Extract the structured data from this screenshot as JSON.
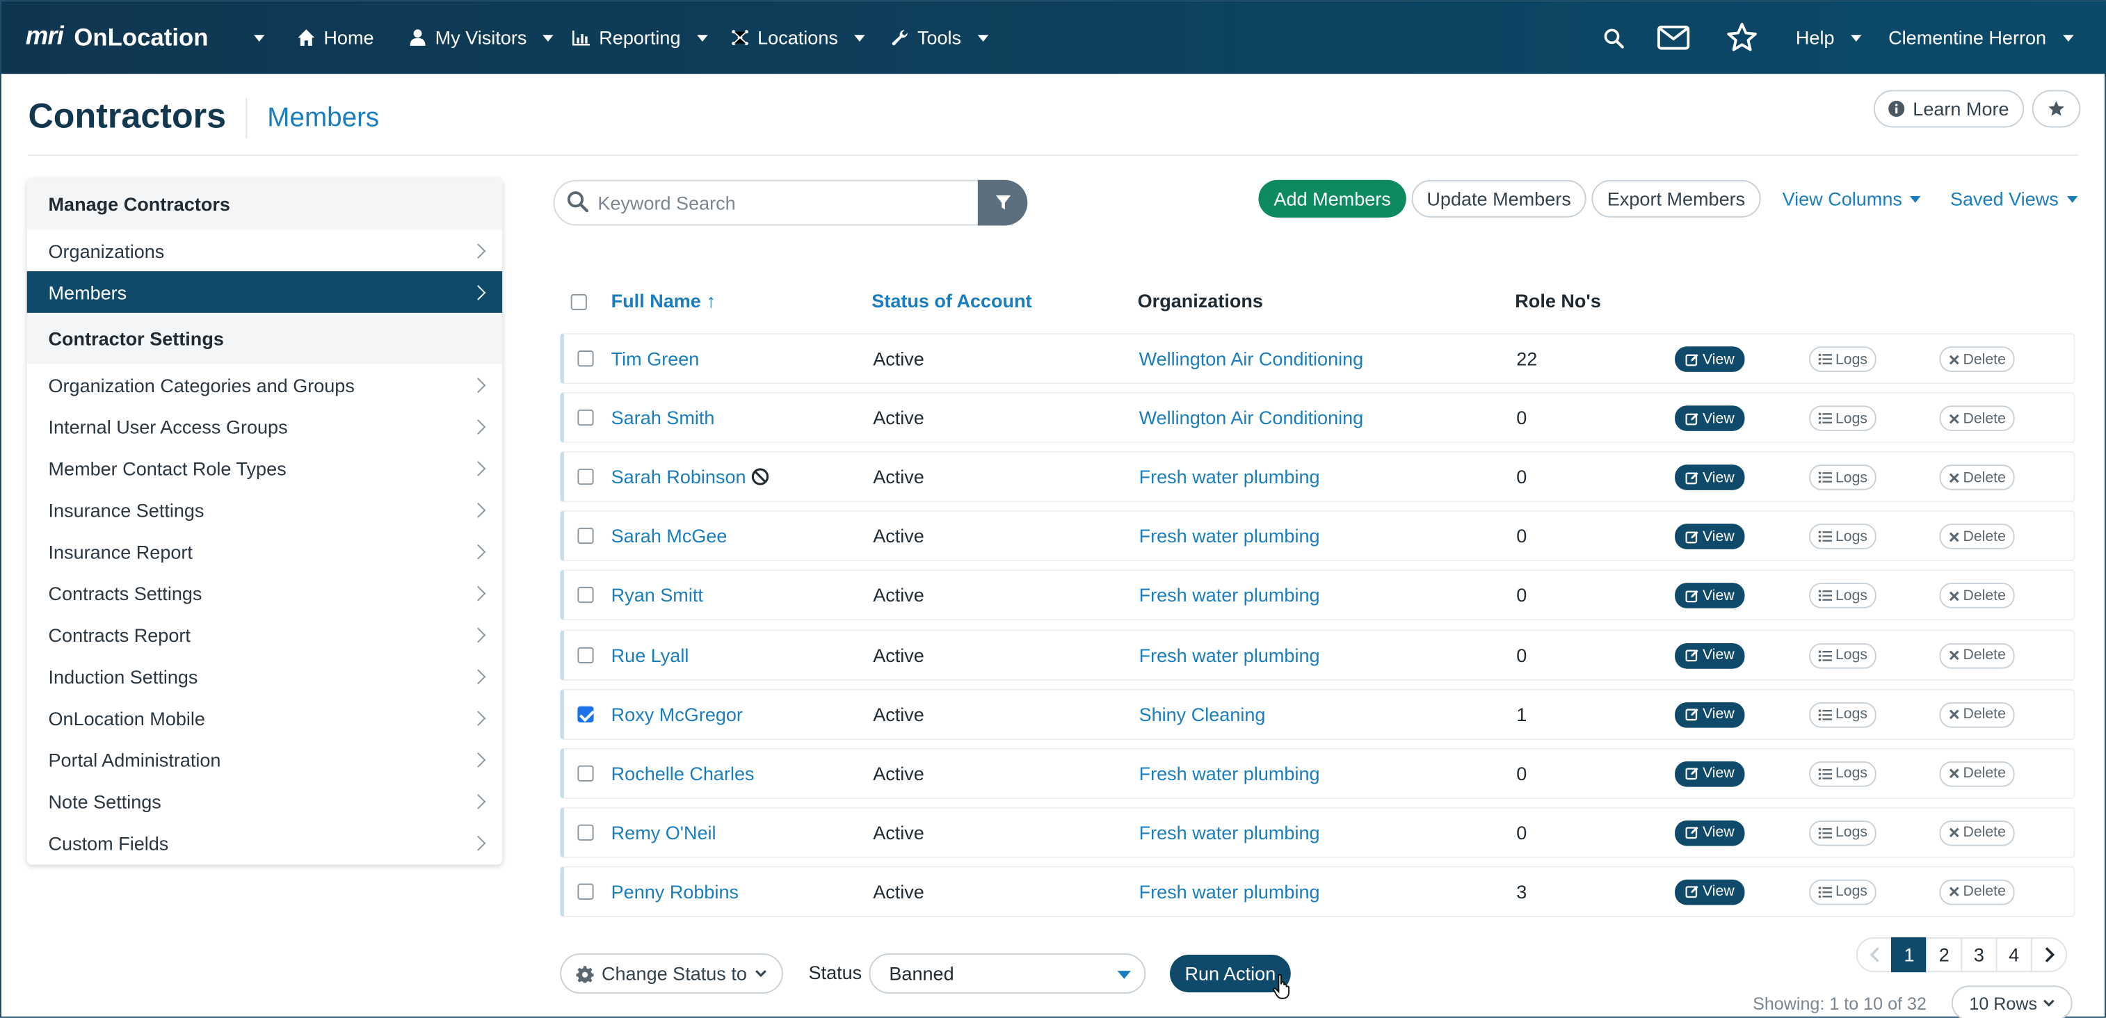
{
  "app": {
    "brand": "mri",
    "name": "OnLocation"
  },
  "topnav": {
    "items": [
      {
        "label": "Home",
        "icon": "home-icon"
      },
      {
        "label": "My Visitors",
        "icon": "user-icon"
      },
      {
        "label": "Reporting",
        "icon": "chart-icon"
      },
      {
        "label": "Locations",
        "icon": "network-icon"
      },
      {
        "label": "Tools",
        "icon": "wrench-icon"
      }
    ],
    "help": "Help",
    "user": "Clementine Herron"
  },
  "header": {
    "title": "Contractors",
    "subtitle": "Members",
    "learn_more": "Learn More"
  },
  "sidebar": {
    "section1": "Manage Contractors",
    "section1_items": [
      {
        "label": "Organizations",
        "active": false
      },
      {
        "label": "Members",
        "active": true
      }
    ],
    "section2": "Contractor Settings",
    "section2_items": [
      {
        "label": "Organization Categories and Groups"
      },
      {
        "label": "Internal User Access Groups"
      },
      {
        "label": "Member Contact Role Types"
      },
      {
        "label": "Insurance Settings"
      },
      {
        "label": "Insurance Report"
      },
      {
        "label": "Contracts Settings"
      },
      {
        "label": "Contracts Report"
      },
      {
        "label": "Induction Settings"
      },
      {
        "label": "OnLocation Mobile"
      },
      {
        "label": "Portal Administration"
      },
      {
        "label": "Note Settings"
      },
      {
        "label": "Custom Fields"
      }
    ]
  },
  "toolbar": {
    "search_placeholder": "Keyword Search",
    "add_members": "Add Members",
    "update_members": "Update Members",
    "export_members": "Export Members",
    "view_columns": "View Columns",
    "saved_views": "Saved Views"
  },
  "table": {
    "columns": {
      "full_name": "Full Name",
      "sort_arrow": "↑",
      "status": "Status of Account",
      "organizations": "Organizations",
      "role_nos": "Role No's"
    },
    "action_labels": {
      "view": "View",
      "logs": "Logs",
      "delete": "Delete"
    },
    "rows": [
      {
        "name": "Tim Green",
        "status": "Active",
        "org": "Wellington Air Conditioning",
        "role": "22",
        "checked": false,
        "banned_icon": false
      },
      {
        "name": "Sarah Smith",
        "status": "Active",
        "org": "Wellington Air Conditioning",
        "role": "0",
        "checked": false,
        "banned_icon": false
      },
      {
        "name": "Sarah Robinson",
        "status": "Active",
        "org": "Fresh water plumbing",
        "role": "0",
        "checked": false,
        "banned_icon": true
      },
      {
        "name": "Sarah McGee",
        "status": "Active",
        "org": "Fresh water plumbing",
        "role": "0",
        "checked": false,
        "banned_icon": false
      },
      {
        "name": "Ryan Smitt",
        "status": "Active",
        "org": "Fresh water plumbing",
        "role": "0",
        "checked": false,
        "banned_icon": false
      },
      {
        "name": "Rue Lyall",
        "status": "Active",
        "org": "Fresh water plumbing",
        "role": "0",
        "checked": false,
        "banned_icon": false
      },
      {
        "name": "Roxy McGregor",
        "status": "Active",
        "org": "Shiny Cleaning",
        "role": "1",
        "checked": true,
        "banned_icon": false
      },
      {
        "name": "Rochelle Charles",
        "status": "Active",
        "org": "Fresh water plumbing",
        "role": "0",
        "checked": false,
        "banned_icon": false
      },
      {
        "name": "Remy O'Neil",
        "status": "Active",
        "org": "Fresh water plumbing",
        "role": "0",
        "checked": false,
        "banned_icon": false
      },
      {
        "name": "Penny Robbins",
        "status": "Active",
        "org": "Fresh water plumbing",
        "role": "3",
        "checked": false,
        "banned_icon": false
      }
    ]
  },
  "bulk": {
    "change_status": "Change Status to",
    "status_label": "Status",
    "status_value": "Banned",
    "run_action": "Run Action"
  },
  "pagination": {
    "pages": [
      "1",
      "2",
      "3",
      "4"
    ],
    "current": "1",
    "showing": "Showing: 1 to 10 of 32",
    "rows": "10 Rows"
  },
  "colors": {
    "nav_bg": "#0f3650",
    "primary": "#0f4a6a",
    "link": "#1a7dbd",
    "success": "#0e8a5f"
  }
}
